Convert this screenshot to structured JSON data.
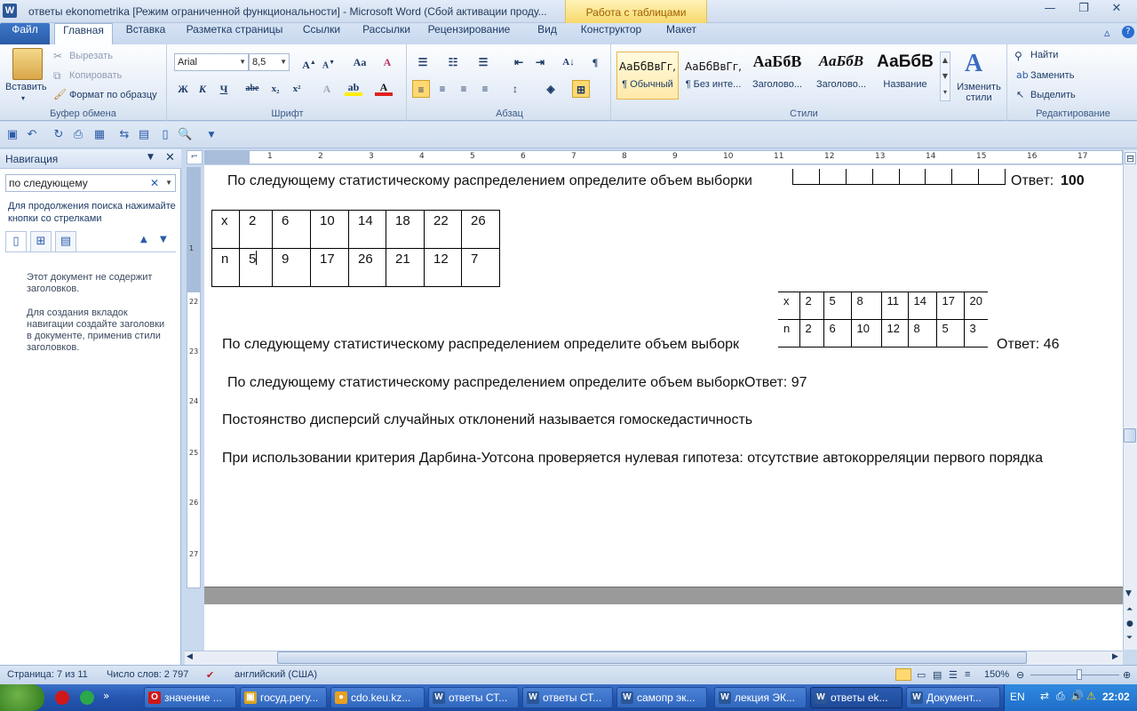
{
  "window": {
    "title": "ответы ekonometrika [Режим ограниченной функциональности]  -  Microsoft Word (Сбой активации проду...",
    "context_tab": "Работа с таблицами",
    "app_icon": "W"
  },
  "tabs": [
    "Файл",
    "Главная",
    "Вставка",
    "Разметка страницы",
    "Ссылки",
    "Рассылки",
    "Рецензирование",
    "Вид",
    "Конструктор",
    "Макет"
  ],
  "ribbon": {
    "clipboard": {
      "label": "Буфер обмена",
      "paste": "Вставить",
      "cut": "Вырезать",
      "copy": "Копировать",
      "format_painter": "Формат по образцу"
    },
    "font": {
      "label": "Шрифт",
      "family": "Arial",
      "size": "8,5"
    },
    "paragraph": {
      "label": "Абзац"
    },
    "styles": {
      "label": "Стили",
      "items": [
        {
          "sample": "АаБбВвГг,",
          "name": "¶ Обычный"
        },
        {
          "sample": "АаБбВвГг,",
          "name": "¶ Без инте..."
        },
        {
          "sample": "АаБбВ",
          "name": "Заголово..."
        },
        {
          "sample": "АаБбВ",
          "name": "Заголово..."
        },
        {
          "sample": "АаБбВ",
          "name": "Название"
        }
      ],
      "change_styles": "Изменить стили"
    },
    "editing": {
      "label": "Редактирование",
      "find": "Найти",
      "replace": "Заменить",
      "select": "Выделить"
    }
  },
  "nav": {
    "title": "Навигация",
    "search_value": "по следующему",
    "hint": "Для продолжения поиска нажимайте кнопки со стрелками",
    "empty_1": "Этот документ не содержит заголовков.",
    "empty_2": "Для создания вкладок навигации создайте заголовки в документе, применив стили заголовков."
  },
  "ruler": {
    "h_numbers": [
      "1",
      "2",
      "3",
      "4",
      "5",
      "6",
      "7",
      "8",
      "9",
      "10",
      "11",
      "12",
      "13",
      "14",
      "15",
      "16",
      "17"
    ],
    "v_numbers": [
      "1",
      "22",
      "23",
      "24",
      "25",
      "26",
      "27"
    ]
  },
  "document": {
    "q1_text": "По следующему статистическому распределением определите объем выборки",
    "q1_answer_label": "Ответ:",
    "q1_answer": "100",
    "table1": {
      "x_label": "x",
      "x_values": [
        "2",
        "6",
        "10",
        "14",
        "18",
        "22",
        "26"
      ],
      "n_label": "n",
      "n_values": [
        "5",
        "9",
        "17",
        "26",
        "21",
        "12",
        "7"
      ]
    },
    "table2": {
      "x_label": "x",
      "x_values": [
        "2",
        "5",
        "8",
        "11",
        "14",
        "17",
        "20"
      ],
      "n_label": "n",
      "n_values": [
        "2",
        "6",
        "10",
        "12",
        "8",
        "5",
        "3"
      ]
    },
    "q2_text": "По следующему статистическому распределением определите объем выборк",
    "q2_answer": "Ответ: 46",
    "q3_text": "По следующему статистическому распределением определите объем выборкОтвет: 97",
    "q4_text": "Постоянство дисперсий случайных отклонений называется гомоскедастичность",
    "q5_text": "При использовании критерия Дарбина-Уотсона проверяется нулевая гипотеза: отсутствие автокорреляции первого порядка"
  },
  "status": {
    "page": "Страница: 7 из 11",
    "words": "Число слов: 2 797",
    "language": "английский (США)",
    "zoom": "150%"
  },
  "taskbar": {
    "items": [
      {
        "label": "значение ...",
        "icon": "O",
        "color": "#d01818"
      },
      {
        "label": "госуд.регу...",
        "icon": "▣",
        "color": "#d9a520"
      },
      {
        "label": "cdo.keu.kz...",
        "icon": "●",
        "color": "#e8a020"
      },
      {
        "label": "ответы СТ...",
        "icon": "W",
        "color": "#2b5797"
      },
      {
        "label": "ответы СТ...",
        "icon": "W",
        "color": "#2b5797"
      },
      {
        "label": "самопр эк...",
        "icon": "W",
        "color": "#2b5797"
      },
      {
        "label": "лекция ЭК...",
        "icon": "W",
        "color": "#2b5797"
      },
      {
        "label": "ответы ek...",
        "icon": "W",
        "color": "#2b5797"
      },
      {
        "label": "Документ...",
        "icon": "W",
        "color": "#2b5797"
      }
    ],
    "lang": "EN",
    "clock": "22:02"
  }
}
